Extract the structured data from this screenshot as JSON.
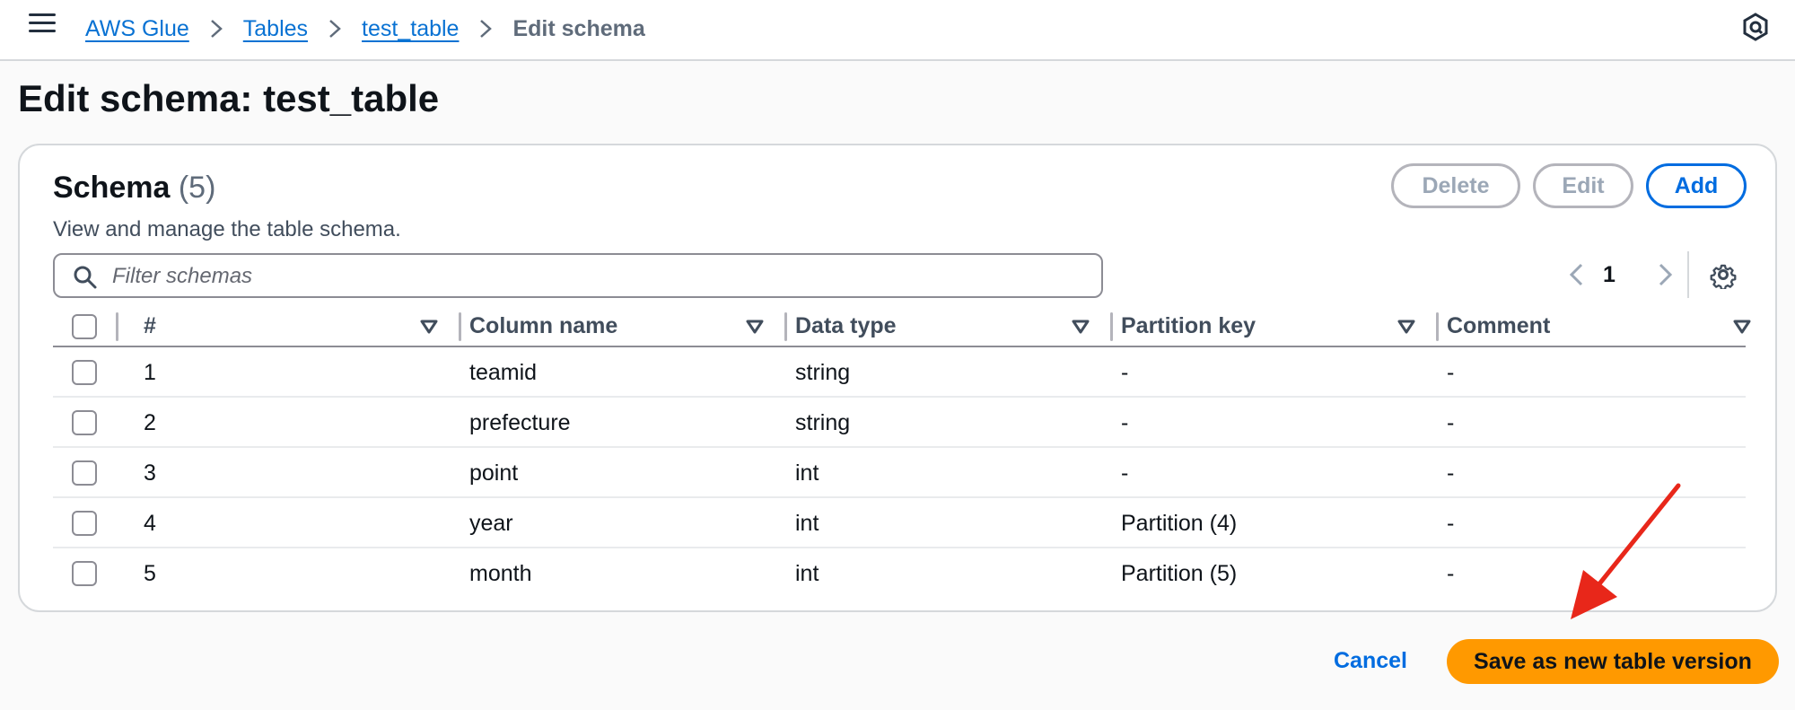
{
  "breadcrumbs": [
    {
      "label": "AWS Glue"
    },
    {
      "label": "Tables"
    },
    {
      "label": "test_table"
    },
    {
      "label": "Edit schema"
    }
  ],
  "page": {
    "title": "Edit schema: test_table"
  },
  "schema": {
    "heading": "Schema",
    "count": "(5)",
    "description": "View and manage the table schema.",
    "buttons": {
      "delete": "Delete",
      "edit": "Edit",
      "add": "Add"
    },
    "filter_placeholder": "Filter schemas",
    "page_number": "1",
    "columns": [
      "#",
      "Column name",
      "Data type",
      "Partition key",
      "Comment"
    ],
    "rows": [
      {
        "num": "1",
        "name": "teamid",
        "type": "string",
        "partition": "-",
        "comment": "-"
      },
      {
        "num": "2",
        "name": "prefecture",
        "type": "string",
        "partition": "-",
        "comment": "-"
      },
      {
        "num": "3",
        "name": "point",
        "type": "int",
        "partition": "-",
        "comment": "-"
      },
      {
        "num": "4",
        "name": "year",
        "type": "int",
        "partition": "Partition (4)",
        "comment": "-"
      },
      {
        "num": "5",
        "name": "month",
        "type": "int",
        "partition": "Partition (5)",
        "comment": "-"
      }
    ]
  },
  "footer": {
    "cancel": "Cancel",
    "save": "Save as new table version"
  },
  "colors": {
    "link": "#0972d3",
    "primary": "#ff9900",
    "annotation_arrow": "#e8271a"
  }
}
